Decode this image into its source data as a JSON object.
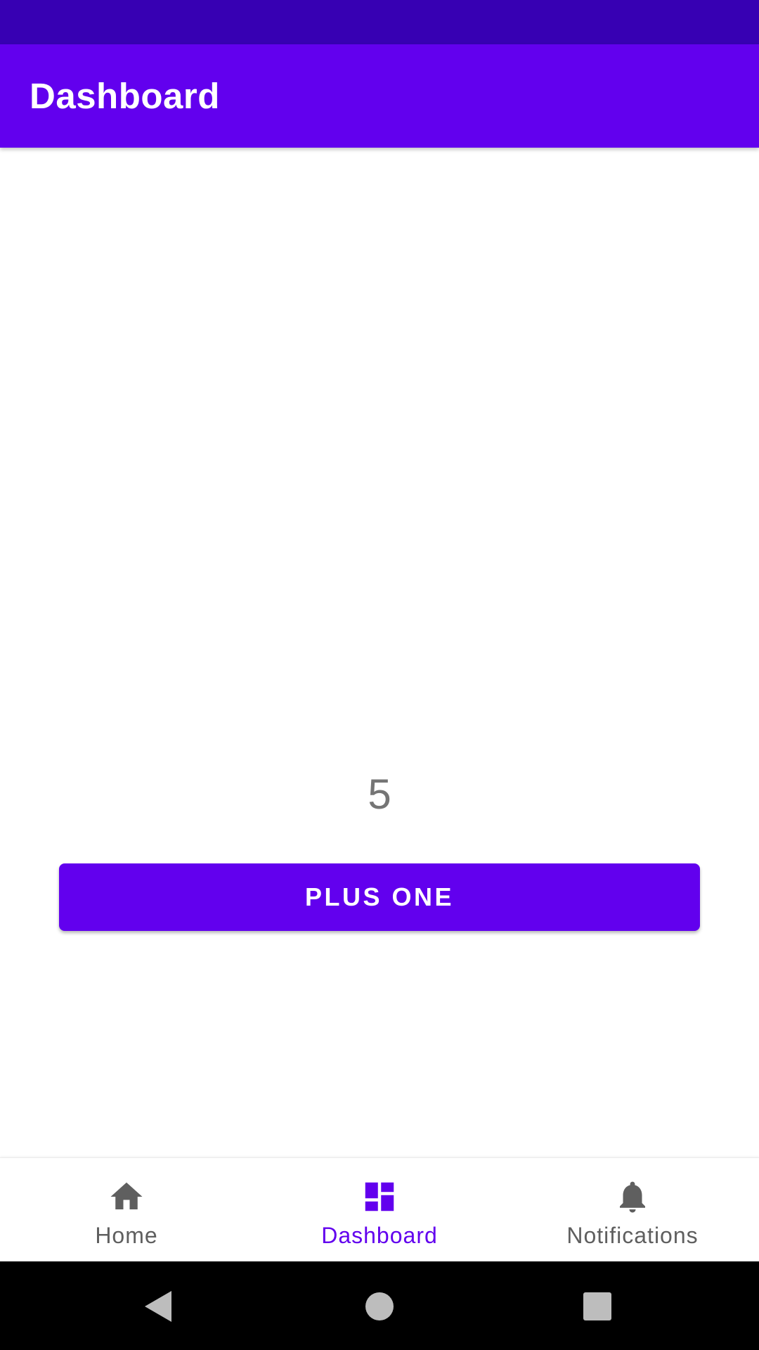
{
  "app_bar": {
    "title": "Dashboard",
    "color": "#6200EE",
    "status_bar_color": "#3700B3"
  },
  "counter": {
    "value": "5"
  },
  "button": {
    "label": "PLUS ONE"
  },
  "bottom_nav": {
    "active_color": "#6200EE",
    "inactive_color": "#5f5f5f",
    "items": [
      {
        "label": "Home",
        "icon": "home-icon",
        "active": false
      },
      {
        "label": "Dashboard",
        "icon": "dashboard-icon",
        "active": true
      },
      {
        "label": "Notifications",
        "icon": "bell-icon",
        "active": false
      }
    ]
  },
  "system_nav": {
    "buttons": [
      "back-icon",
      "home-circle-icon",
      "recents-icon"
    ]
  }
}
